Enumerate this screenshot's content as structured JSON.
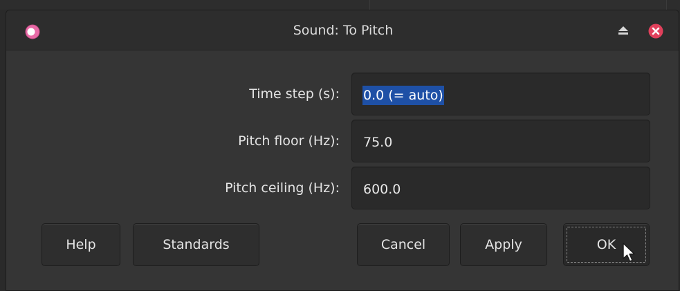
{
  "window": {
    "title": "Sound: To Pitch",
    "icons": {
      "app": "praat-app-icon",
      "shade": "eject-icon",
      "close": "close-icon"
    },
    "close_color": "#e0405b"
  },
  "form": {
    "fields": [
      {
        "label": "Time step (s):",
        "value": "0.0 (= auto)",
        "selected": true
      },
      {
        "label": "Pitch floor (Hz):",
        "value": "75.0",
        "selected": false
      },
      {
        "label": "Pitch ceiling (Hz):",
        "value": "600.0",
        "selected": false
      }
    ]
  },
  "buttons": {
    "help": "Help",
    "standards": "Standards",
    "cancel": "Cancel",
    "apply": "Apply",
    "ok": "OK"
  },
  "colors": {
    "selection": "#1e50a6",
    "app_icon": "#e86aa6"
  }
}
